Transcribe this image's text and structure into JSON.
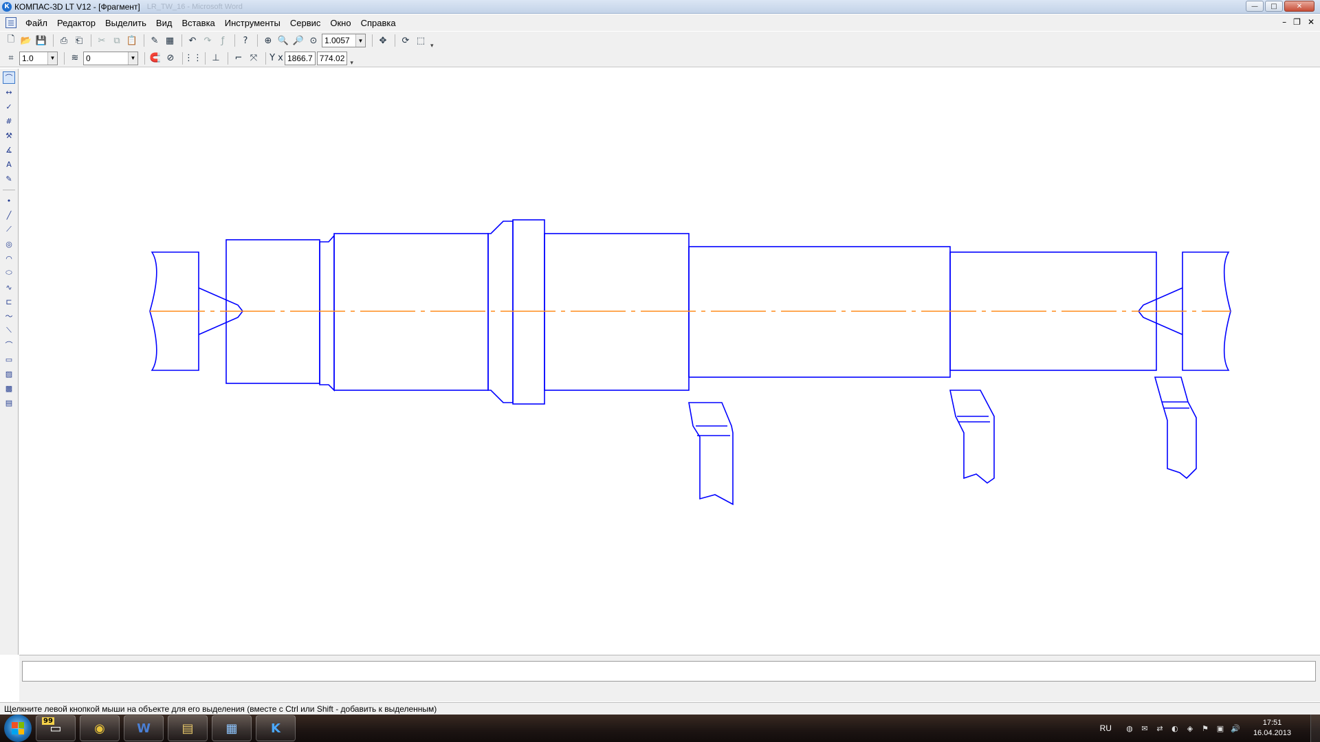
{
  "window": {
    "title": "КОМПАС-3D LT V12 - [Фрагмент]",
    "ghost_title": "LR_TW_16 - Microsoft Word",
    "app_logo_letter": "К",
    "minimize": "—",
    "maximize": "□",
    "close": "✕"
  },
  "menu": {
    "items": [
      "Файл",
      "Редактор",
      "Выделить",
      "Вид",
      "Вставка",
      "Инструменты",
      "Сервис",
      "Окно",
      "Справка"
    ],
    "mdi_min": "–",
    "mdi_restore": "❐",
    "mdi_close": "✕"
  },
  "toolbar1": {
    "zoom_value": "1.0057"
  },
  "toolbar2": {
    "step_value": "1.0",
    "layer_value": "0",
    "coord_x": "1866.7",
    "coord_y": "774.02",
    "coord_label": "Y x"
  },
  "statusbar": {
    "hint": "Щелкните левой кнопкой мыши на объекте для его выделения (вместе с Ctrl или Shift - добавить к выделенным)"
  },
  "taskbar": {
    "items": [
      {
        "name": "explorer-badge",
        "badge": "99"
      },
      {
        "name": "chrome",
        "label": "◉"
      },
      {
        "name": "word",
        "label": "W"
      },
      {
        "name": "files",
        "label": "▤"
      },
      {
        "name": "gallery",
        "label": "▦"
      },
      {
        "name": "kompas",
        "label": "K"
      }
    ],
    "lang": "RU",
    "time": "17:51",
    "date": "16.04.2013"
  },
  "drawing": {
    "stroke_color": "#0000ff",
    "axis_color": "#ff8c1a"
  }
}
